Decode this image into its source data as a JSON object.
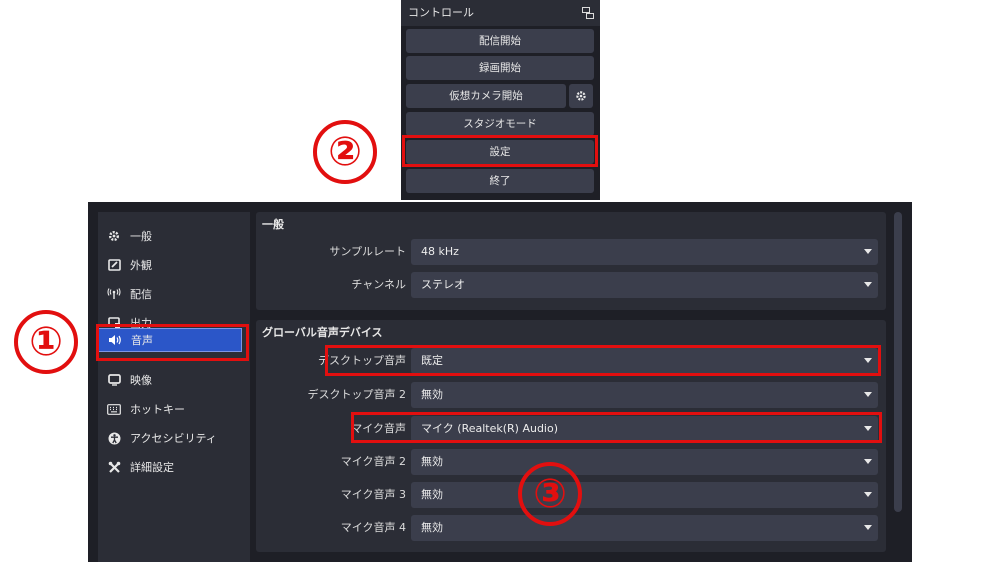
{
  "controls": {
    "title": "コントロール",
    "buttons": {
      "start_stream": "配信開始",
      "start_record": "録画開始",
      "start_virtualcam": "仮想カメラ開始",
      "studio_mode": "スタジオモード",
      "settings": "設定",
      "exit": "終了"
    },
    "icons": {
      "undock": "undock-icon",
      "gear": "gear-icon"
    }
  },
  "sidebar": {
    "items": [
      {
        "label": "一般",
        "icon": "gear-icon"
      },
      {
        "label": "外観",
        "icon": "appearance-icon"
      },
      {
        "label": "配信",
        "icon": "antenna-icon"
      },
      {
        "label": "出力",
        "icon": "output-icon"
      },
      {
        "label": "音声",
        "icon": "speaker-icon",
        "active": true
      },
      {
        "label": "映像",
        "icon": "monitor-icon"
      },
      {
        "label": "ホットキー",
        "icon": "keyboard-icon"
      },
      {
        "label": "アクセシビリティ",
        "icon": "accessibility-icon"
      },
      {
        "label": "詳細設定",
        "icon": "tools-icon"
      }
    ]
  },
  "general": {
    "title": "一般",
    "sample_rate": {
      "label": "サンプルレート",
      "value": "48 kHz"
    },
    "channels": {
      "label": "チャンネル",
      "value": "ステレオ"
    }
  },
  "global_audio": {
    "title": "グローバル音声デバイス",
    "rows": [
      {
        "label": "デスクトップ音声",
        "value": "既定"
      },
      {
        "label": "デスクトップ音声 2",
        "value": "無効"
      },
      {
        "label": "マイク音声",
        "value": "マイク (Realtek(R) Audio)"
      },
      {
        "label": "マイク音声 2",
        "value": "無効"
      },
      {
        "label": "マイク音声 3",
        "value": "無効"
      },
      {
        "label": "マイク音声 4",
        "value": "無効"
      }
    ]
  },
  "annotations": {
    "step1": "①",
    "step2": "②",
    "step3": "③",
    "color": "#e20f0f"
  },
  "colors": {
    "panel": "#2b2d36",
    "window": "#1e1f26",
    "button": "#3b3e4c",
    "active": "#2b56c8"
  }
}
